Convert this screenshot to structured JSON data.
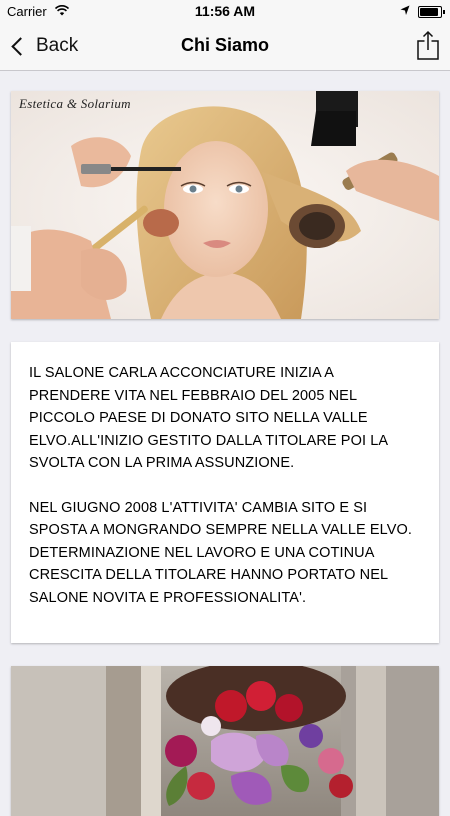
{
  "status_bar": {
    "carrier": "Carrier",
    "time": "11:56 AM",
    "battery_level": 0.9
  },
  "nav": {
    "back_label": "Back",
    "title": "Chi Siamo"
  },
  "image_card": {
    "caption": "Estetica & Solarium"
  },
  "text_card": {
    "paragraphs": [
      "IL SALONE CARLA ACCONCIATURE INIZIA A PRENDERE VITA NEL FEBBRAIO DEL 2005 NEL PICCOLO PAESE DI DONATO SITO NELLA VALLE ELVO.ALL'INIZIO GESTITO DALLA TITOLARE POI LA SVOLTA CON LA PRIMA ASSUNZIONE.",
      "NEL GIUGNO 2008 L'ATTIVITA' CAMBIA SITO E SI SPOSTA A MONGRANDO SEMPRE NELLA VALLE ELVO.",
      "DETERMINAZIONE NEL LAVORO E UNA COTINUA CRESCITA DELLA TITOLARE HANNO PORTATO NEL SALONE NOVITA E PROFESSIONALITA'."
    ]
  }
}
